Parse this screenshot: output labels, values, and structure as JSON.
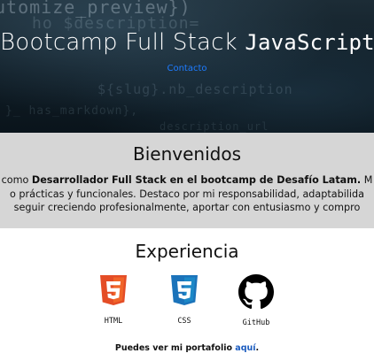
{
  "hero": {
    "bg_code_lines": [
      "utomize_preview})",
      "ho $description=",
      "${slug}.nb_description",
      "}_ has_markdown},",
      "description_url"
    ],
    "title_text": "Bootcamp Full Stack",
    "title_mono": "JavaScript",
    "contact_link": "Contacto"
  },
  "welcome": {
    "heading": "Bienvenidos",
    "line1_prefix": "como ",
    "line1_bold1": "Desarrollador Full Stack en el bootcamp de Desafío Latam.",
    "line1_suffix": " M",
    "line2": "o prácticas y funcionales. Destaco por mi responsabilidad, adaptabilida",
    "line3": "seguir creciendo profesionalmente, aportar con entusiasmo y compro"
  },
  "experience": {
    "heading": "Experiencia",
    "techs": [
      {
        "label": "HTML",
        "icon": "html5-icon",
        "color": "#e44d26"
      },
      {
        "label": "CSS",
        "icon": "css3-icon",
        "color": "#1b73ba"
      },
      {
        "label": "GitHub",
        "icon": "github-icon",
        "color": "#000000"
      }
    ],
    "portfolio_prefix": "Puedes ver mi portafolio ",
    "portfolio_link": "aquí",
    "portfolio_suffix": "."
  }
}
